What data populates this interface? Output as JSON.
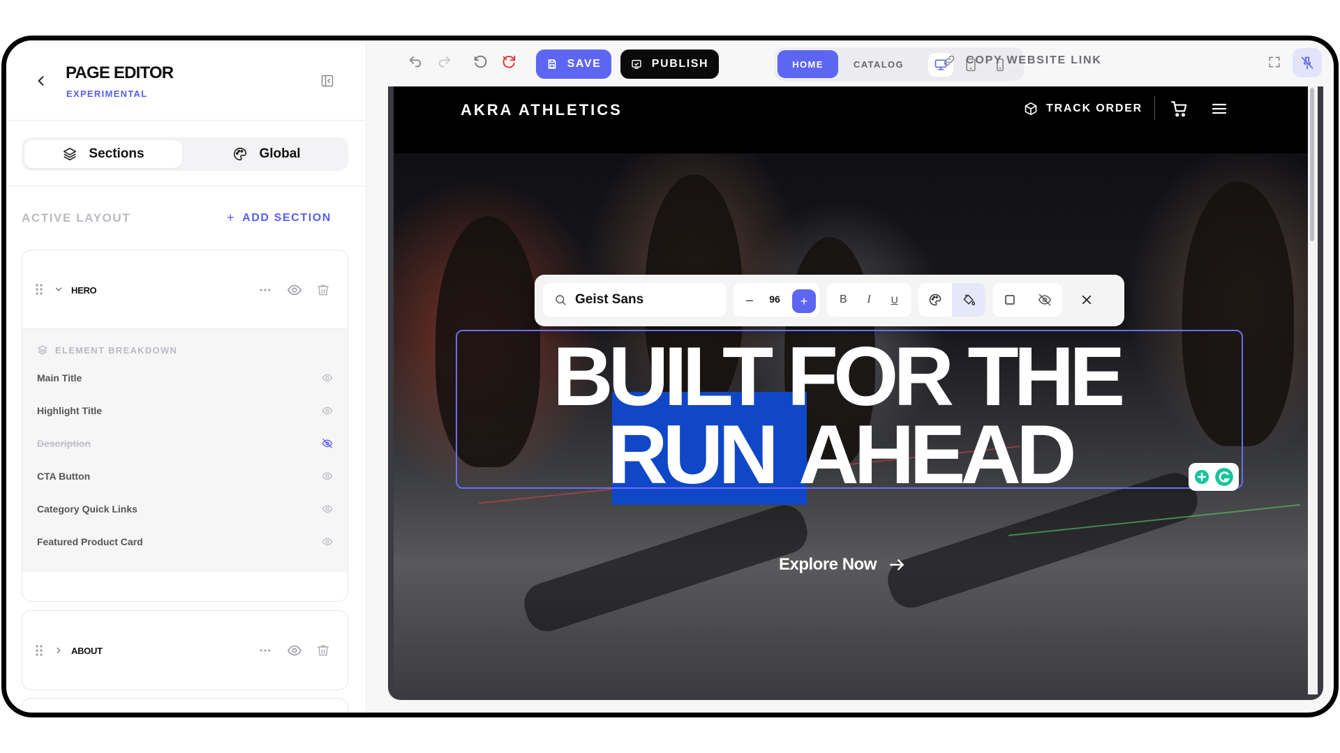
{
  "sidebar": {
    "title": "PAGE EDITOR",
    "subtitle": "EXPERIMENTAL",
    "tabs": [
      {
        "label": "Sections",
        "icon": "layers-icon",
        "active": true
      },
      {
        "label": "Global",
        "icon": "palette-icon",
        "active": false
      }
    ],
    "active_layout_label": "ACTIVE LAYOUT",
    "add_section_label": "ADD SECTION",
    "sections": [
      {
        "name": "HERO",
        "expanded": true,
        "breakdown_title": "ELEMENT BREAKDOWN",
        "elements": [
          {
            "label": "Main Title",
            "visible": true
          },
          {
            "label": "Highlight Title",
            "visible": true
          },
          {
            "label": "Description",
            "visible": false
          },
          {
            "label": "CTA Button",
            "visible": true
          },
          {
            "label": "Category Quick Links",
            "visible": true
          },
          {
            "label": "Featured Product Card",
            "visible": true
          }
        ]
      },
      {
        "name": "ABOUT",
        "expanded": false
      }
    ]
  },
  "toolbar": {
    "save_label": "SAVE",
    "publish_label": "PUBLISH",
    "page_tabs": [
      {
        "label": "HOME",
        "active": true
      },
      {
        "label": "CATALOG",
        "active": false
      }
    ],
    "devices": [
      "desktop",
      "tablet",
      "mobile"
    ],
    "active_device": "desktop",
    "copy_link_label": "COPY WEBSITE LINK"
  },
  "site": {
    "logo": "AKRA ATHLETICS",
    "track_order_label": "TRACK ORDER",
    "hero": {
      "title_line1": "BUILT FOR THE",
      "title_line2_highlight": "RUN",
      "title_line2_rest": "AHEAD",
      "cta_label": "Explore Now"
    }
  },
  "font_toolbar": {
    "font_name": "Geist Sans",
    "font_size": "96",
    "minus_label": "–",
    "plus_label": "+",
    "bold_label": "B",
    "italic_label": "I",
    "underline_label": "U"
  },
  "colors": {
    "accent": "#5d66f2",
    "highlight": "#0f47c6",
    "site_background": "#000000"
  }
}
